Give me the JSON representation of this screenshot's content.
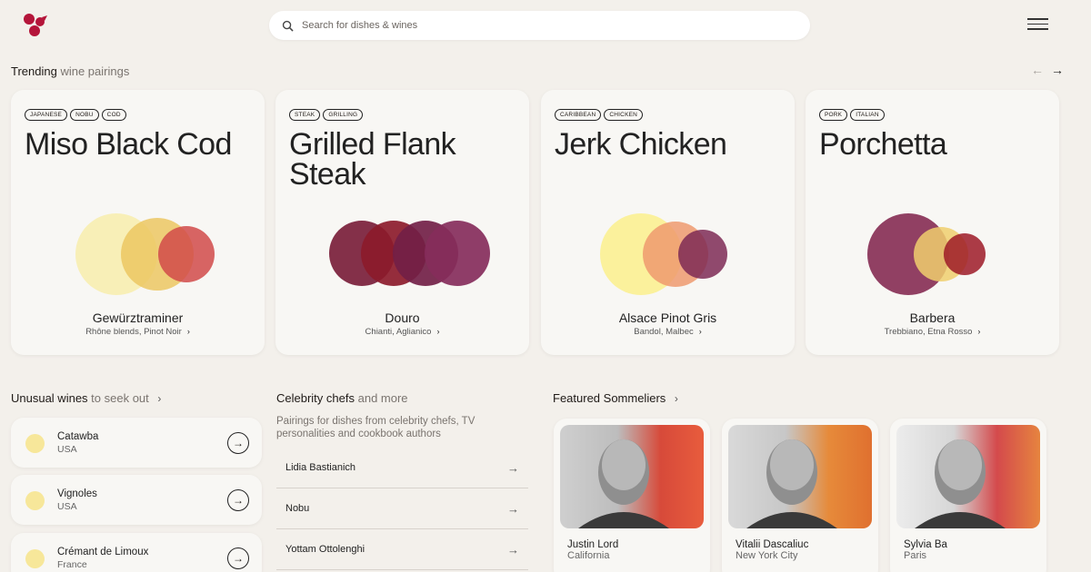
{
  "search": {
    "placeholder": "Search for dishes & wines",
    "icon": "search-icon"
  },
  "trending": {
    "title": "Trending",
    "title_muted": "wine pairings",
    "cards": [
      {
        "tags": [
          "JAPANESE",
          "NOBU",
          "COD"
        ],
        "dish": "Miso Black Cod",
        "wine": "Gewürztraminer",
        "alternatives": "Rhône blends, Pinot Noir",
        "circle_colors": [
          "#f8edac",
          "#ecc762",
          "#d14a49"
        ]
      },
      {
        "tags": [
          "STEAK",
          "GRILLING"
        ],
        "dish": "Grilled Flank Steak",
        "wine": "Douro",
        "alternatives": "Chianti, Aglianico",
        "circle_colors": [
          "#7a1e3a",
          "#8c1b2b",
          "#721f47",
          "#852c5b"
        ]
      },
      {
        "tags": [
          "CARIBBEAN",
          "CHICKEN"
        ],
        "dish": "Jerk Chicken",
        "wine": "Alsace Pinot Gris",
        "alternatives": "Bandol, Malbec",
        "circle_colors": [
          "#fbf08c",
          "#ef9a6f",
          "#7e2a55"
        ]
      },
      {
        "tags": [
          "PORK",
          "ITALIAN"
        ],
        "dish": "Porchetta",
        "wine": "Barbera",
        "alternatives": "Trebbiano, Etna Rosso",
        "circle_colors": [
          "#7f2049",
          "#f0cf6d",
          "#9d1a27"
        ]
      }
    ]
  },
  "unusual": {
    "title": "Unusual wines",
    "title_muted": "to seek out",
    "items": [
      {
        "name": "Catawba",
        "country": "USA"
      },
      {
        "name": "Vignoles",
        "country": "USA"
      },
      {
        "name": "Crémant de Limoux",
        "country": "France"
      }
    ]
  },
  "chefs": {
    "title": "Celebrity chefs",
    "title_muted": "and more",
    "description": "Pairings for dishes from celebrity chefs, TV personalities and cookbook authors",
    "items": [
      "Lidia Bastianich",
      "Nobu",
      "Yottam Ottolenghi"
    ]
  },
  "sommeliers": {
    "title": "Featured Sommeliers",
    "items": [
      {
        "name": "Justin Lord",
        "location": "California"
      },
      {
        "name": "Vitalii Dascaliuc",
        "location": "New York City"
      },
      {
        "name": "Sylvia Ba",
        "location": "Paris"
      }
    ]
  },
  "colors": {
    "background": "#f3f0eb",
    "card": "#f8f7f4",
    "brand": "#b4153a"
  }
}
